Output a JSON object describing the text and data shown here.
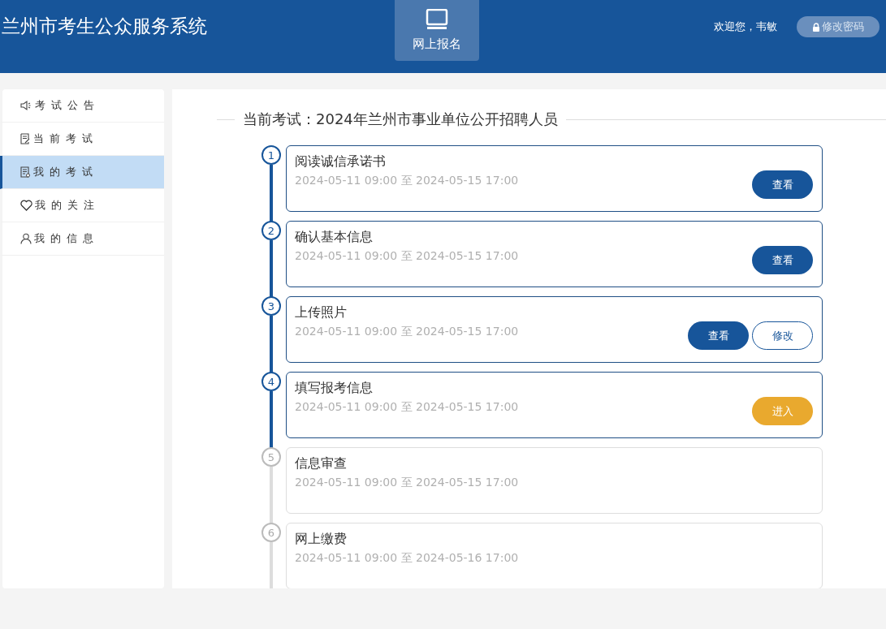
{
  "header": {
    "title": "兰州市考生公众服务系统",
    "nav": [
      {
        "label": "网上报名",
        "selected": true
      }
    ],
    "welcome": "欢迎您，韦敏",
    "change_password": "修改密码"
  },
  "sidebar": {
    "items": [
      {
        "label": "考试公告",
        "kind": "announcement",
        "selected": false
      },
      {
        "label": "当前考试",
        "kind": "current",
        "selected": false
      },
      {
        "label": "我的考试",
        "kind": "exams",
        "selected": true
      },
      {
        "label": "我的关注",
        "kind": "follows",
        "selected": false
      },
      {
        "label": "我的信息",
        "kind": "profile",
        "selected": false
      }
    ]
  },
  "main": {
    "heading": "当前考试：2024年兰州市事业单位公开招聘人员",
    "steps": [
      {
        "number": "1",
        "title": "阅读诚信承诺书",
        "period": "2024-05-11 09:00 至 2024-05-15 17:00",
        "active": true,
        "buttons": [
          {
            "label": "查看",
            "kind": "primary"
          }
        ]
      },
      {
        "number": "2",
        "title": "确认基本信息",
        "period": "2024-05-11 09:00 至 2024-05-15 17:00",
        "active": true,
        "buttons": [
          {
            "label": "查看",
            "kind": "primary"
          }
        ]
      },
      {
        "number": "3",
        "title": "上传照片",
        "period": "2024-05-11 09:00 至 2024-05-15 17:00",
        "active": true,
        "buttons": [
          {
            "label": "查看",
            "kind": "primary"
          },
          {
            "label": "修改",
            "kind": "outline"
          }
        ]
      },
      {
        "number": "4",
        "title": "填写报考信息",
        "period": "2024-05-11 09:00 至 2024-05-15 17:00",
        "active": true,
        "buttons": [
          {
            "label": "进入",
            "kind": "warning"
          }
        ]
      },
      {
        "number": "5",
        "title": "信息审查",
        "period": "2024-05-11 09:00 至 2024-05-15 17:00",
        "active": false
      },
      {
        "number": "6",
        "title": "网上缴费",
        "period": "2024-05-11 09:00 至 2024-05-16 17:00",
        "active": false
      }
    ]
  }
}
